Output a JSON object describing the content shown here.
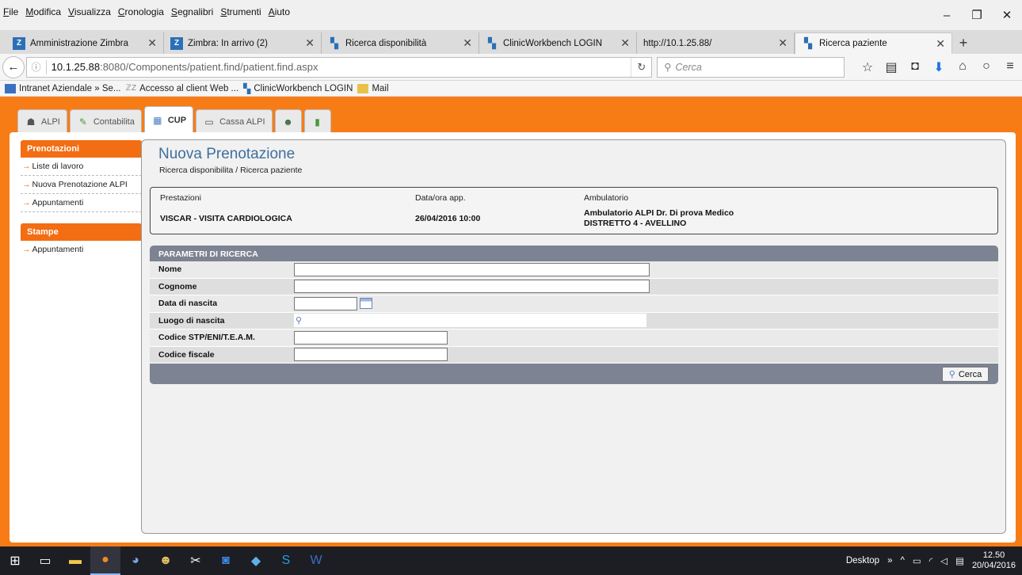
{
  "menu": [
    "File",
    "Modifica",
    "Visualizza",
    "Cronologia",
    "Segnalibri",
    "Strumenti",
    "Aiuto"
  ],
  "tabs": [
    {
      "label": "Amministrazione Zimbra",
      "icon": "zimbra-icon",
      "active": false
    },
    {
      "label": "Zimbra: In arrivo (2)",
      "icon": "zimbra-mail-icon",
      "active": false
    },
    {
      "label": "Ricerca disponibilità",
      "icon": "clinicworkbench-icon",
      "active": false
    },
    {
      "label": "ClinicWorkbench LOGIN",
      "icon": "clinicworkbench-icon",
      "active": false
    },
    {
      "label": "http://10.1.25.88/",
      "icon": "",
      "active": false
    },
    {
      "label": "Ricerca paziente",
      "icon": "clinicworkbench-icon",
      "active": true
    }
  ],
  "url": {
    "host": "10.1.25.88",
    "path": ":8080/Components/patient.find/patient.find.aspx"
  },
  "search": {
    "placeholder": "Cerca"
  },
  "bookmarks": [
    "Intranet Aziendale » Se...",
    "Accesso al client Web ...",
    "ClinicWorkbench LOGIN",
    "Mail"
  ],
  "app_tabs": [
    {
      "label": "ALPI",
      "active": false
    },
    {
      "label": "Contabilita",
      "active": false
    },
    {
      "label": "CUP",
      "active": true
    },
    {
      "label": "Cassa ALPI",
      "active": false
    },
    {
      "label": "",
      "active": false
    },
    {
      "label": "",
      "active": false
    }
  ],
  "sidebar": {
    "prenotazioni": {
      "title": "Prenotazioni",
      "items": [
        "Liste di lavoro",
        "Nuova Prenotazione ALPI",
        "Appuntamenti"
      ]
    },
    "stampe": {
      "title": "Stampe",
      "items": [
        "Appuntamenti"
      ]
    }
  },
  "page": {
    "title": "Nuova Prenotazione",
    "breadcrumb": "Ricerca disponibilita / Ricerca paziente"
  },
  "info": {
    "prestazioni_label": "Prestazioni",
    "prestazioni_value": "VISCAR - VISITA CARDIOLOGICA",
    "data_label": "Data/ora app.",
    "data_value": "26/04/2016 10:00",
    "ambulatorio_label": "Ambulatorio",
    "ambulatorio_line1": "Ambulatorio ALPI Dr. Di prova Medico",
    "ambulatorio_line2": "DISTRETTO 4 - AVELLINO"
  },
  "params": {
    "title": "PARAMETRI DI RICERCA",
    "fields": {
      "nome": {
        "label": "Nome",
        "value": ""
      },
      "cognome": {
        "label": "Cognome",
        "value": ""
      },
      "data_nascita": {
        "label": "Data di nascita",
        "value": ""
      },
      "luogo_nascita": {
        "label": "Luogo di nascita",
        "value": ""
      },
      "codice_stp": {
        "label": "Codice STP/ENI/T.E.A.M.",
        "value": ""
      },
      "codice_fiscale": {
        "label": "Codice fiscale",
        "value": ""
      }
    },
    "search_button": "Cerca"
  },
  "taskbar": {
    "desktop_label": "Desktop",
    "time": "12.50",
    "date": "20/04/2016"
  },
  "colors": {
    "app_orange": "#f87c16",
    "menu_orange": "#f36d13",
    "title_blue": "#3e6f9e",
    "params_header": "#7d8393"
  }
}
